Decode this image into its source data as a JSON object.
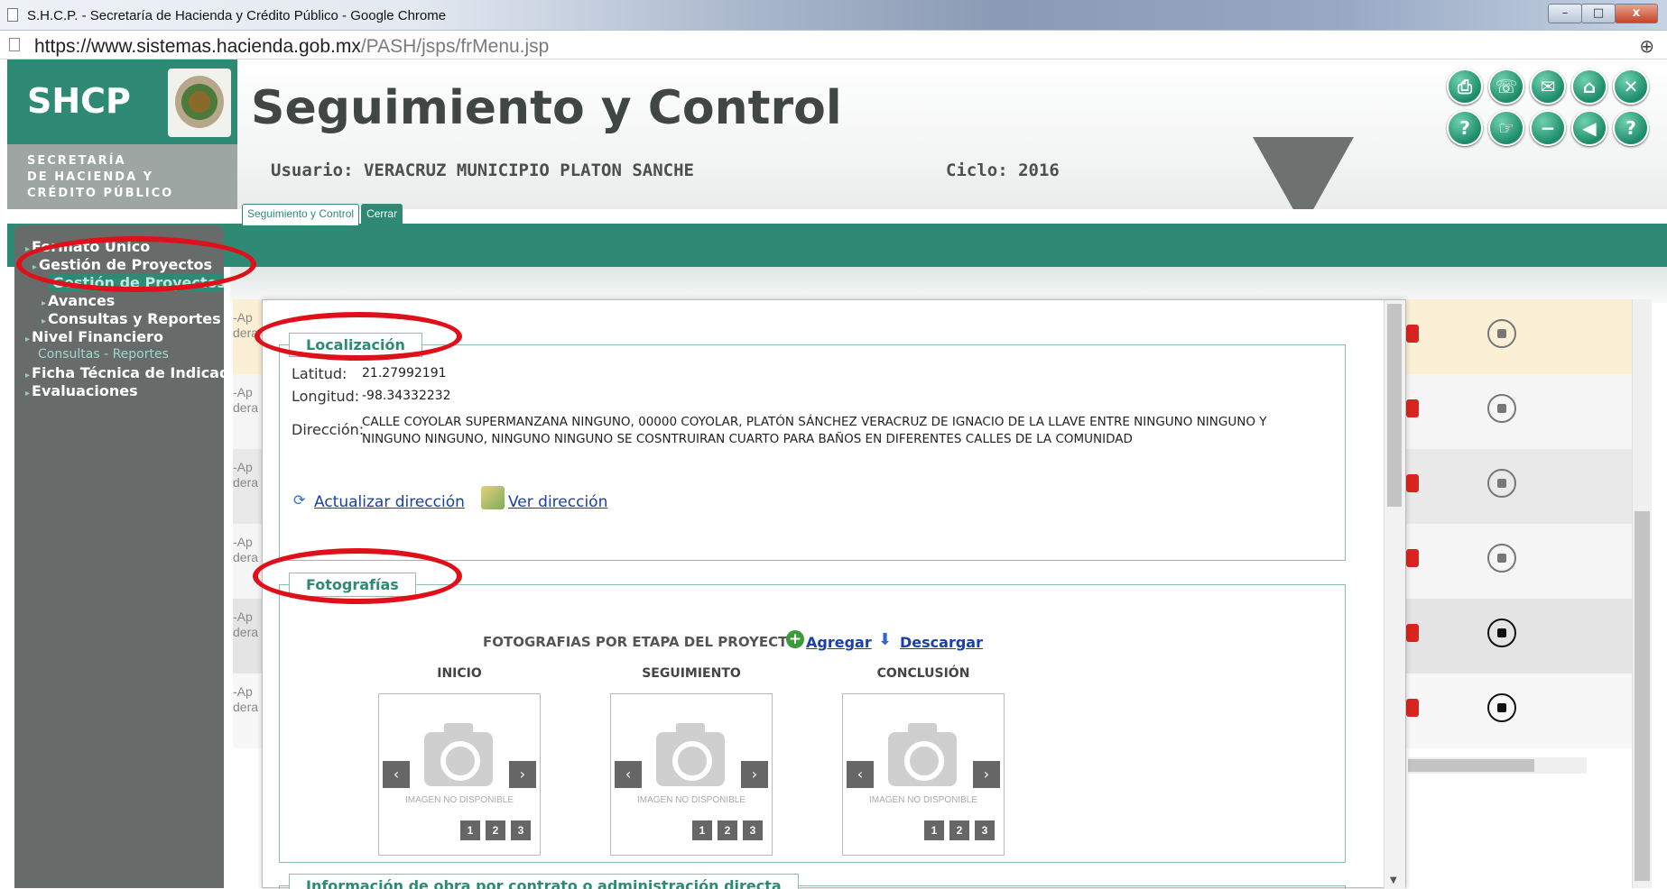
{
  "browser": {
    "window_title": "S.H.C.P. - Secretaría de Hacienda y Crédito Público - Google Chrome",
    "url_host": "https://www.sistemas.hacienda.gob.mx",
    "url_path": "/PASH/jsps/frMenu.jsp",
    "win_minimize": "–",
    "win_maximize": "□",
    "win_close": "x"
  },
  "header": {
    "logo": "SHCP",
    "logo_sub_1": "SECRETARÍA",
    "logo_sub_2": "DE HACIENDA Y",
    "logo_sub_3": "CRÉDITO PÚBLICO",
    "app_title": "Seguimiento y Control",
    "user": "Usuario: VERACRUZ MUNICIPIO PLATON SANCHE",
    "ciclo": "Ciclo: 2016",
    "toolbar_icons": [
      "printer-icon",
      "phone-icon",
      "mail-icon",
      "home-icon",
      "close-icon",
      "help-doc-icon",
      "hand-pointer-icon",
      "minus-icon",
      "back-icon",
      "question-icon"
    ]
  },
  "tabs": [
    {
      "label": "Seguimiento y Control",
      "active": false
    },
    {
      "label": "Cerrar",
      "active": true
    }
  ],
  "sidebar": {
    "items": [
      {
        "label": "Formato Único"
      },
      {
        "label": "Gestión de Proyectos"
      },
      {
        "label": "Gestión de Proyectos"
      },
      {
        "label": "Avances"
      },
      {
        "label": "Consultas y Reportes"
      },
      {
        "label": "Nivel Financiero"
      },
      {
        "label": "Consultas - Reportes"
      },
      {
        "label": "Ficha Técnica de Indicadores"
      },
      {
        "label": "Evaluaciones"
      }
    ]
  },
  "background_rows": [
    {
      "text": "-Ap dera"
    },
    {
      "text": "-Ap dera"
    },
    {
      "text": "-Ap dera"
    },
    {
      "text": "-Ap dera"
    },
    {
      "text": "-Ap dera"
    },
    {
      "text": "-Ap dera"
    }
  ],
  "localizacion": {
    "legend": "Localización",
    "latitud_label": "Latitud:",
    "latitud": "21.27992191",
    "longitud_label": "Longitud:",
    "longitud": "-98.34332232",
    "direccion_label": "Dirección:",
    "direccion": "CALLE COYOLAR SUPERMANZANA NINGUNO, 00000 COYOLAR, PLATÓN SÁNCHEZ VERACRUZ DE IGNACIO DE LA LLAVE ENTRE NINGUNO NINGUNO Y NINGUNO NINGUNO, NINGUNO NINGUNO SE COSNTRUIRAN CUARTO PARA BAÑOS EN DIFERENTES CALLES DE LA COMUNIDAD",
    "actualizar": "Actualizar dirección",
    "ver": "Ver dirección"
  },
  "fotografias": {
    "legend": "Fotografías",
    "title": "FOTOGRAFIAS POR ETAPA DEL PROYECTO",
    "agregar": "Agregar",
    "descargar": "Descargar",
    "no_disponible": "IMAGEN NO DISPONIBLE",
    "stages": [
      {
        "title": "INICIO",
        "pages": [
          "1",
          "2",
          "3"
        ]
      },
      {
        "title": "SEGUIMIENTO",
        "pages": [
          "1",
          "2",
          "3"
        ]
      },
      {
        "title": "CONCLUSIÓN",
        "pages": [
          "1",
          "2",
          "3"
        ]
      }
    ]
  },
  "informacion": {
    "legend": "Información de obra por contrato o administración directa"
  },
  "colors": {
    "brand_green": "#2e8a74",
    "sidebar_gray": "#676b69",
    "annotation_red": "#e0101a"
  }
}
